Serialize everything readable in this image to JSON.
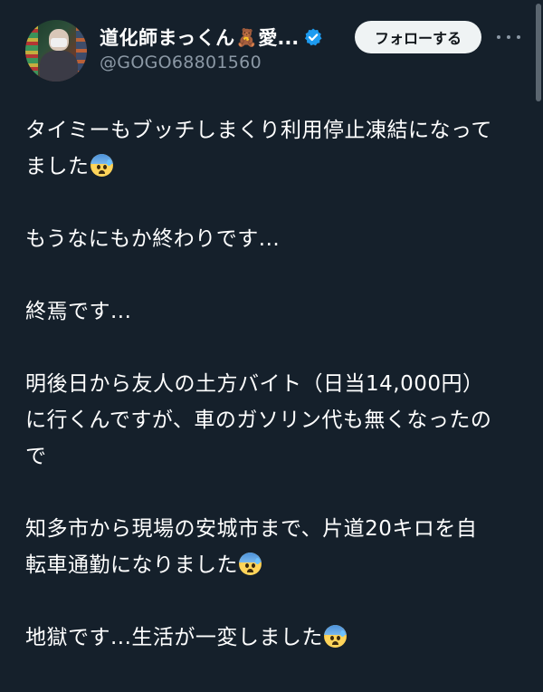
{
  "profile": {
    "display_name": "道化師まっくん",
    "name_emoji": "🧸",
    "name_tail": "愛...",
    "handle": "@GOGO68801560",
    "verified": true
  },
  "actions": {
    "follow_label": "フォローする"
  },
  "icons": {
    "verified": "verified-badge-icon",
    "more": "more-dots-icon",
    "emoji": "anxious-face-with-sweat-emoji"
  },
  "colors": {
    "background": "#15202b",
    "text": "#ffffff",
    "secondary_text": "#8b98a5",
    "verified_blue": "#1d9bf0",
    "follow_button_bg": "#eff3f4"
  },
  "tweet": {
    "p1": {
      "line1": "タイミーもブッチしまくり利用停止凍結になって",
      "line2": "ました"
    },
    "p2": "もうなにもか終わりです...",
    "p3": "終焉です...",
    "p4": {
      "line1": "明後日から友人の土方バイト（日当14,000円）",
      "line2": "に行くんですが、車のガソリン代も無くなったの",
      "line3": "で"
    },
    "p5": {
      "line1": "知多市から現場の安城市まで、片道20キロを自",
      "line2": "転車通勤になりました"
    },
    "p6": "地獄です...生活が一変しました"
  }
}
